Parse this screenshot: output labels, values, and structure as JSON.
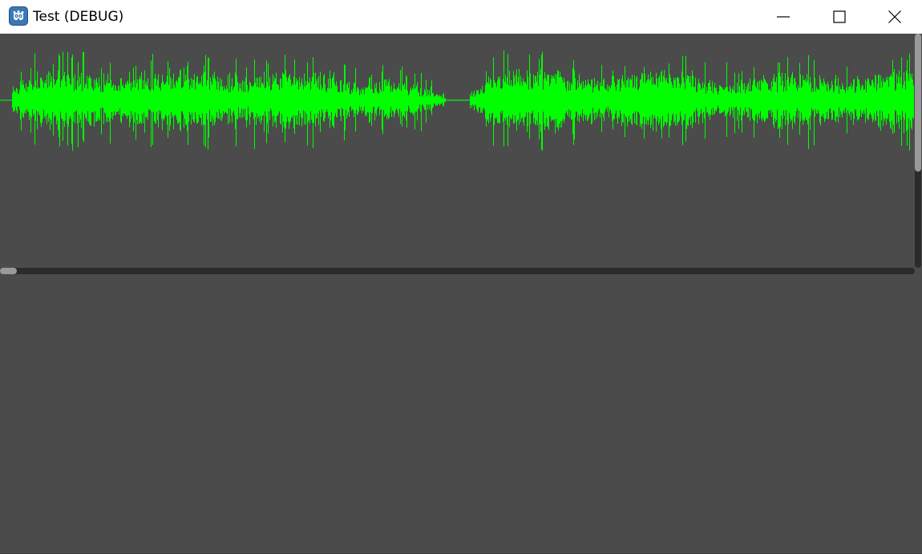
{
  "window": {
    "title": "Test (DEBUG)",
    "app_icon": "godot-icon",
    "controls": {
      "minimize": "minimize-icon",
      "maximize": "maximize-icon",
      "close": "close-icon"
    }
  },
  "waveform": {
    "color": "#00ff00",
    "background": "#4b4b4b",
    "silent_region_fraction": [
      0.487,
      0.514
    ]
  },
  "scrollbars": {
    "horizontal_position": 0.0,
    "vertical_position": 0.0,
    "vertical_visible_fraction": 0.59
  },
  "colors": {
    "titlebar": "#ffffff",
    "client_bg": "#4b4b4b",
    "scroll_track": "#2b2b2b",
    "scroll_thumb": "#9a9a9a"
  }
}
